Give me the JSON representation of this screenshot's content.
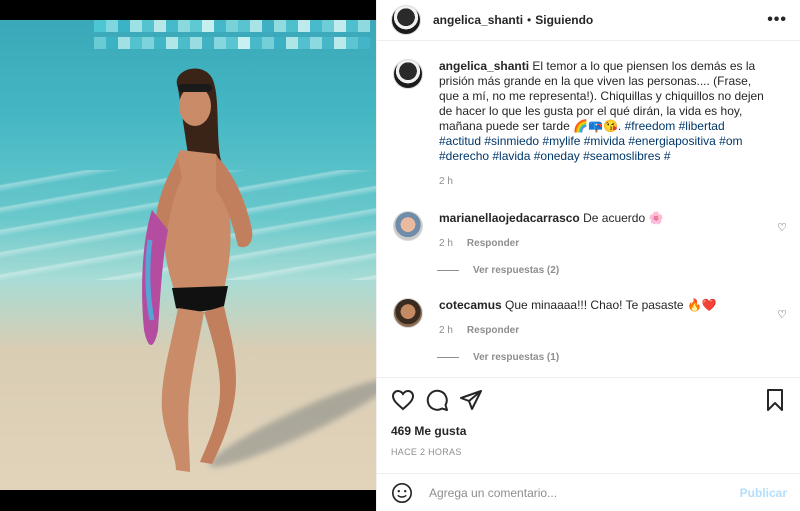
{
  "post": {
    "username": "angelica_shanti",
    "separator": "•",
    "follow_status": "Siguiendo",
    "more": "•••"
  },
  "caption": {
    "username": "angelica_shanti",
    "text": "El temor a lo que piensen los demás es la prisión más grande en la que viven las personas.... (Frase, que a mí, no me representa!). Chiquillas y chiquillos no dejen de hacer lo que les gusta por el qué dirán, la vida es hoy, mañana puede ser tarde 🌈📪😘.",
    "hashtags": "#freedom #libertad #actitud #sinmiedo #mylife #mivida #energiapositiva #om #derecho #lavida #oneday #seamoslibres #",
    "time": "2 h"
  },
  "comments": [
    {
      "username": "marianellaojedacarrasco",
      "text": "De acuerdo 🌸",
      "time": "2 h",
      "reply": "Responder",
      "view_replies": "Ver respuestas (2)"
    },
    {
      "username": "cotecamus",
      "text": "Que minaaaa!!! Chao! Te pasaste 🔥❤️",
      "time": "2 h",
      "reply": "Responder",
      "view_replies": "Ver respuestas (1)"
    }
  ],
  "stats": {
    "likes": "469 Me gusta",
    "posted": "HACE 2 HORAS"
  },
  "composer": {
    "placeholder": "Agrega un comentario...",
    "publish": "Publicar"
  },
  "icons": [
    "heart-icon",
    "comment-icon",
    "share-icon",
    "bookmark-icon",
    "emoji-icon",
    "more-options-icon"
  ]
}
